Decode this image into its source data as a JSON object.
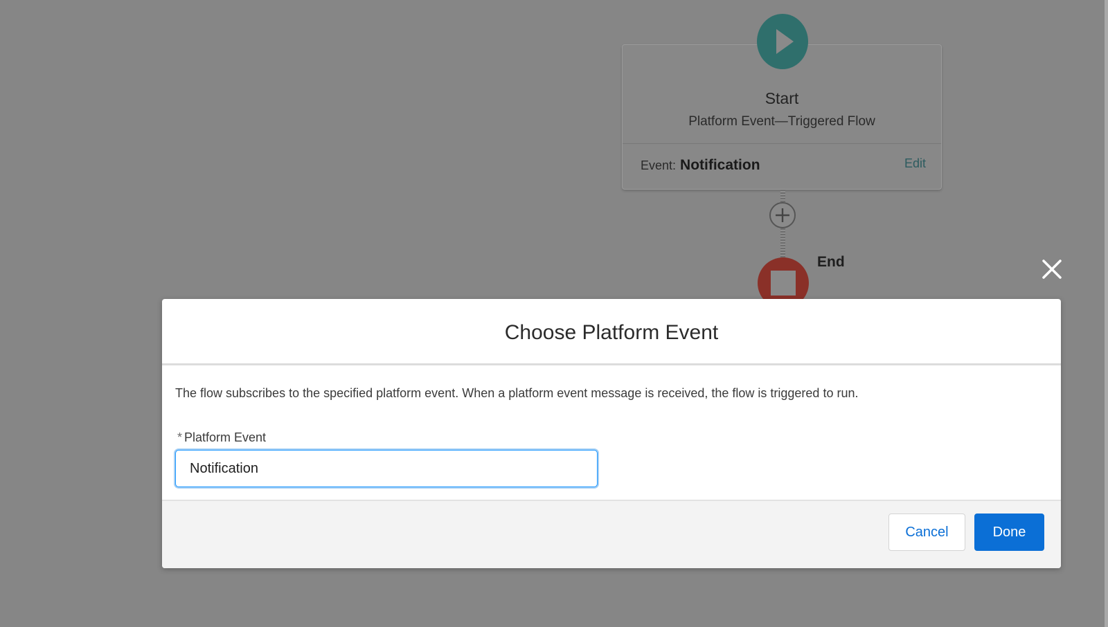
{
  "canvas": {
    "start_node": {
      "title": "Start",
      "subtitle": "Platform Event—Triggered Flow",
      "event_label": "Event:",
      "event_value": "Notification",
      "edit_label": "Edit",
      "icon": "play-icon"
    },
    "add_element_icon": "plus-icon",
    "end_node": {
      "label": "End",
      "icon": "stop-icon"
    }
  },
  "close_icon": "close-icon",
  "modal": {
    "title": "Choose Platform Event",
    "description": "The flow subscribes to the specified platform event. When a platform event message is received, the flow is triggered to run.",
    "field": {
      "required_marker": "*",
      "label": "Platform Event",
      "value": "Notification"
    },
    "buttons": {
      "cancel": "Cancel",
      "done": "Done"
    }
  },
  "colors": {
    "overlay": "#868686",
    "start_node": "#2f6f6c",
    "end_node": "#8a3028",
    "brand_blue": "#0b6fd6",
    "focus_border": "#1b96ff"
  }
}
